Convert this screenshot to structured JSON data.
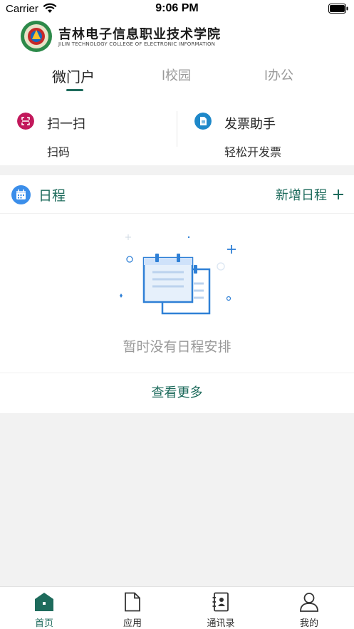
{
  "status_bar": {
    "carrier": "Carrier",
    "time": "9:06 PM"
  },
  "header": {
    "school_name_cn": "吉林电子信息职业技术学院",
    "school_name_en": "JILIN TECHNOLOGY COLLEGE OF ELECTRONIC INFORMATION"
  },
  "tabs": [
    {
      "label": "微门户",
      "active": true
    },
    {
      "label": "l校园",
      "active": false
    },
    {
      "label": "l办公",
      "active": false
    }
  ],
  "quick_actions": [
    {
      "title": "扫一扫",
      "subtitle": "扫码",
      "icon": "scan-icon",
      "color": "#c2185b"
    },
    {
      "title": "发票助手",
      "subtitle": "轻松开发票",
      "icon": "invoice-icon",
      "color": "#1e88c9"
    }
  ],
  "schedule": {
    "title": "日程",
    "add_label": "新增日程",
    "empty_text": "暂时没有日程安排",
    "view_more": "查看更多"
  },
  "bottom_nav": [
    {
      "label": "首页",
      "icon": "home-icon",
      "active": true
    },
    {
      "label": "应用",
      "icon": "document-icon",
      "active": false
    },
    {
      "label": "通讯录",
      "icon": "contacts-icon",
      "active": false
    },
    {
      "label": "我的",
      "icon": "user-icon",
      "active": false
    }
  ],
  "colors": {
    "accent": "#1e6b5c",
    "scan": "#c2185b",
    "invoice": "#1e88c9",
    "calendar": "#3b8eea",
    "illustration": "#2f80d6"
  }
}
